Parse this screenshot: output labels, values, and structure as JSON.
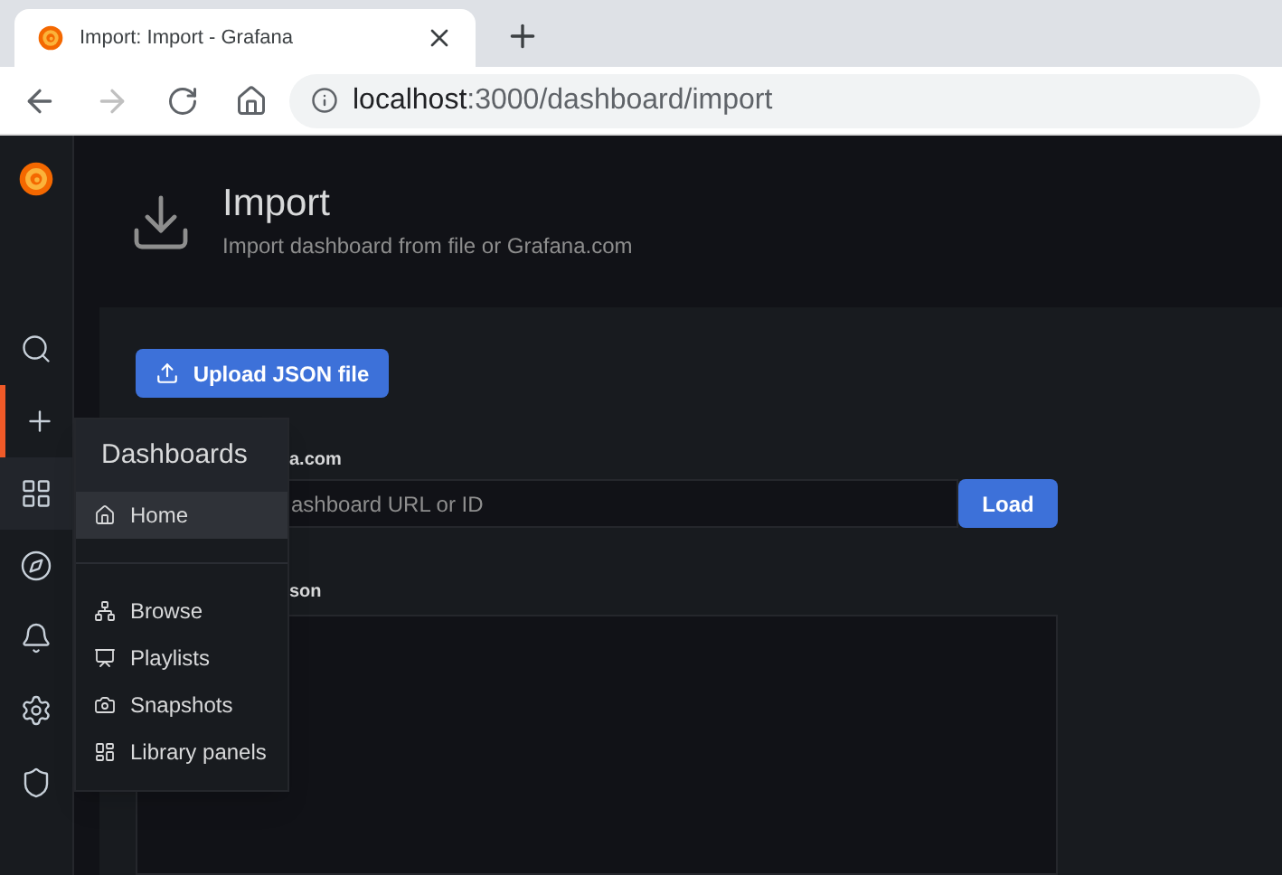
{
  "browser": {
    "tab_title": "Import: Import - Grafana",
    "url_host": "localhost",
    "url_path": ":3000/dashboard/import"
  },
  "sidebar": {
    "items": [
      {
        "kind": "search",
        "selected": false,
        "highlighted": false
      },
      {
        "kind": "create",
        "selected": true,
        "highlighted": false
      },
      {
        "kind": "dashboards",
        "selected": false,
        "highlighted": true
      },
      {
        "kind": "explore",
        "selected": false,
        "highlighted": false
      },
      {
        "kind": "alerting",
        "selected": false,
        "highlighted": false
      },
      {
        "kind": "configuration",
        "selected": false,
        "highlighted": false
      },
      {
        "kind": "admin",
        "selected": false,
        "highlighted": false
      }
    ]
  },
  "header": {
    "title": "Import",
    "subtitle": "Import dashboard from file or Grafana.com"
  },
  "upload_button": "Upload JSON file",
  "grafana_com": {
    "label": "a.com",
    "placeholder": "ashboard URL or ID",
    "button": "Load"
  },
  "json_panel": {
    "label": "son"
  },
  "dashboards_menu": {
    "title": "Dashboards",
    "items": [
      {
        "kind": "home",
        "label": "Home",
        "selected": true
      },
      {
        "kind": "browse",
        "label": "Browse",
        "selected": false
      },
      {
        "kind": "playlists",
        "label": "Playlists",
        "selected": false
      },
      {
        "kind": "snapshots",
        "label": "Snapshots",
        "selected": false
      },
      {
        "kind": "library",
        "label": "Library panels",
        "selected": false
      }
    ]
  }
}
